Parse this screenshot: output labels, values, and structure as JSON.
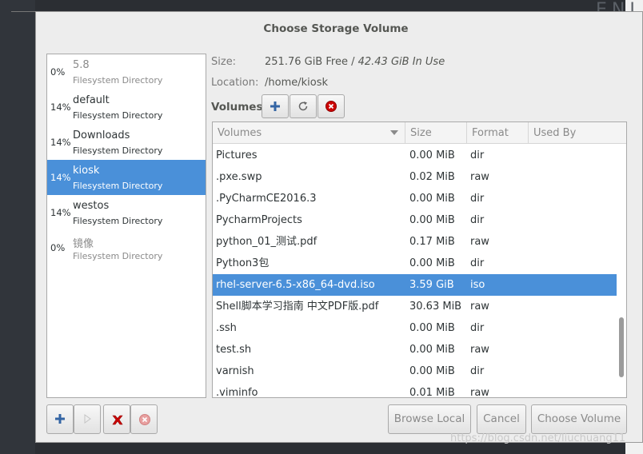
{
  "dialog": {
    "title": "Choose Storage Volume"
  },
  "background": {
    "corner_text": "ENI"
  },
  "pools": [
    {
      "percent": "0%",
      "name": "5.8",
      "type": "Filesystem Directory",
      "state": "inactive"
    },
    {
      "percent": "14%",
      "name": "default",
      "type": "Filesystem Directory",
      "state": "active"
    },
    {
      "percent": "14%",
      "name": "Downloads",
      "type": "Filesystem Directory",
      "state": "active"
    },
    {
      "percent": "14%",
      "name": "kiosk",
      "type": "Filesystem Directory",
      "state": "selected"
    },
    {
      "percent": "14%",
      "name": "westos",
      "type": "Filesystem Directory",
      "state": "active"
    },
    {
      "percent": "0%",
      "name": "镜像",
      "type": "Filesystem Directory",
      "state": "inactive"
    }
  ],
  "pool_info": {
    "size_label": "Size:",
    "size_free": "251.76 GiB Free /",
    "size_used": "42.43 GiB In Use",
    "location_label": "Location:",
    "location_value": "/home/kiosk"
  },
  "volumes_toolbar": {
    "label": "Volumes",
    "icons": [
      "add-icon",
      "refresh-icon",
      "stop-icon"
    ]
  },
  "volume_table": {
    "columns": [
      "Volumes",
      "Size",
      "Format",
      "Used By"
    ],
    "rows": [
      {
        "name": "Pictures",
        "size": "0.00 MiB",
        "format": "dir"
      },
      {
        "name": ".pxe.swp",
        "size": "0.02 MiB",
        "format": "raw"
      },
      {
        "name": ".PyCharmCE2016.3",
        "size": "0.00 MiB",
        "format": "dir"
      },
      {
        "name": "PycharmProjects",
        "size": "0.00 MiB",
        "format": "dir"
      },
      {
        "name": "python_01_测试.pdf",
        "size": "0.17 MiB",
        "format": "raw"
      },
      {
        "name": "Python3包",
        "size": "0.00 MiB",
        "format": "dir"
      },
      {
        "name": "rhel-server-6.5-x86_64-dvd.iso",
        "size": "3.59 GiB",
        "format": "iso",
        "selected": true
      },
      {
        "name": "Shell脚本学习指南 中文PDF版.pdf",
        "size": "30.63 MiB",
        "format": "raw"
      },
      {
        "name": ".ssh",
        "size": "0.00 MiB",
        "format": "dir"
      },
      {
        "name": "test.sh",
        "size": "0.00 MiB",
        "format": "raw"
      },
      {
        "name": "varnish",
        "size": "0.00 MiB",
        "format": "dir"
      },
      {
        "name": ".viminfo",
        "size": "0.01 MiB",
        "format": "raw"
      }
    ],
    "sort_icon": "sort-descending-icon"
  },
  "pool_buttons": {
    "icons": [
      "add-pool-icon",
      "start-pool-icon",
      "delete-pool-icon",
      "stop-pool-icon"
    ]
  },
  "buttons": {
    "browse_local": "Browse Local",
    "cancel": "Cancel",
    "choose_volume": "Choose Volume"
  },
  "watermark": "https://blog.csdn.net/liuchuang11",
  "colors": {
    "selection": "#4a90d9",
    "dialog_bg": "#ededed",
    "delete_red": "#cc0000",
    "add_blue": "#3465a4"
  }
}
